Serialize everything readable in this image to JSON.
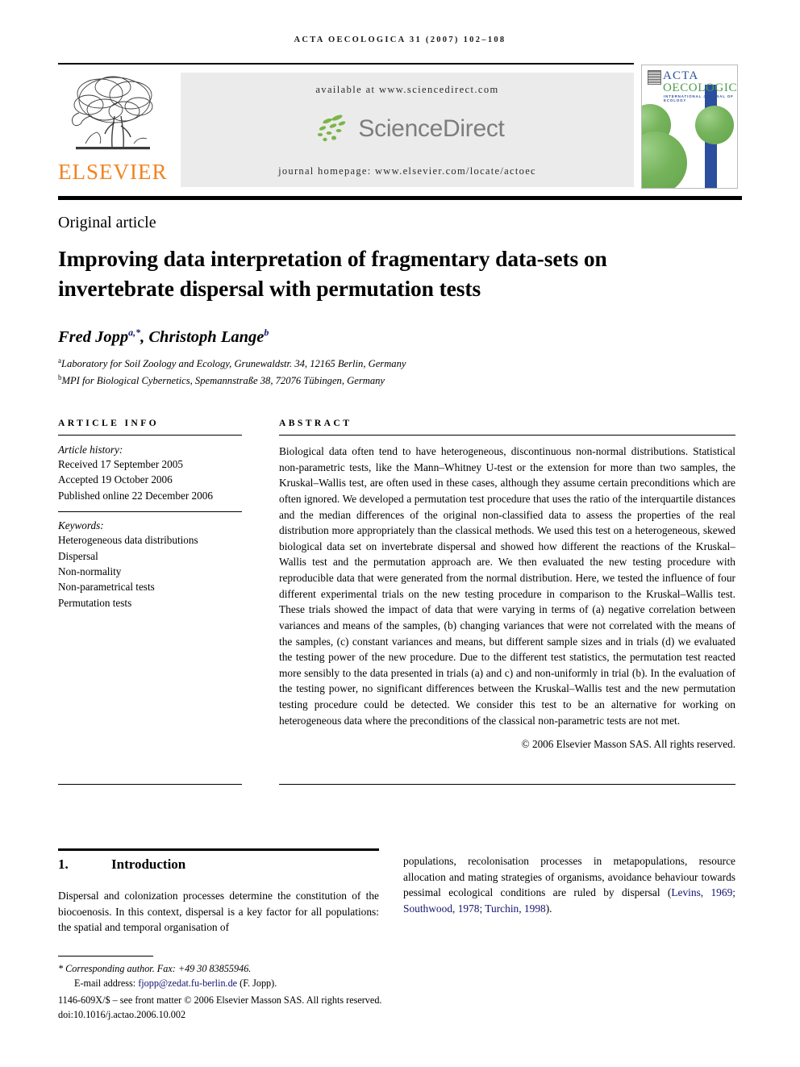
{
  "running_head": "ACTA OECOLOGICA 31 (2007) 102–108",
  "masthead": {
    "publisher_name": "ELSEVIER",
    "available_at": "available at www.sciencedirect.com",
    "sciencedirect_wordmark": "ScienceDirect",
    "journal_homepage": "journal homepage: www.elsevier.com/locate/actoec",
    "cover": {
      "title_line1": "ACTA",
      "title_line2": "OECOLOGICA",
      "subtitle": "INTERNATIONAL JOURNAL OF ECOLOGY"
    }
  },
  "article": {
    "type": "Original article",
    "title": "Improving data interpretation of fragmentary data-sets on invertebrate dispersal with permutation tests",
    "authors": "Fred Jopp, Christoph Lange",
    "author_list": [
      {
        "name": "Fred Jopp",
        "marks": "a,*"
      },
      {
        "name": "Christoph Lange",
        "marks": "b"
      }
    ],
    "affiliations": [
      {
        "mark": "a",
        "text": "Laboratory for Soil Zoology and Ecology, Grunewaldstr. 34, 12165 Berlin, Germany"
      },
      {
        "mark": "b",
        "text": "MPI for Biological Cybernetics, Spemannstraße 38, 72076 Tübingen, Germany"
      }
    ]
  },
  "article_info": {
    "heading": "ARTICLE INFO",
    "history_label": "Article history:",
    "history": [
      "Received 17 September 2005",
      "Accepted 19 October 2006",
      "Published online 22 December 2006"
    ],
    "keywords_label": "Keywords:",
    "keywords": [
      "Heterogeneous data distributions",
      "Dispersal",
      "Non-normality",
      "Non-parametrical tests",
      "Permutation tests"
    ]
  },
  "abstract": {
    "heading": "ABSTRACT",
    "text": "Biological data often tend to have heterogeneous, discontinuous non-normal distributions. Statistical non-parametric tests, like the Mann–Whitney U-test or the extension for more than two samples, the Kruskal–Wallis test, are often used in these cases, although they assume certain preconditions which are often ignored. We developed a permutation test procedure that uses the ratio of the interquartile distances and the median differences of the original non-classified data to assess the properties of the real distribution more appropriately than the classical methods. We used this test on a heterogeneous, skewed biological data set on invertebrate dispersal and showed how different the reactions of the Kruskal–Wallis test and the permutation approach are. We then evaluated the new testing procedure with reproducible data that were generated from the normal distribution. Here, we tested the influence of four different experimental trials on the new testing procedure in comparison to the Kruskal–Wallis test. These trials showed the impact of data that were varying in terms of (a) negative correlation between variances and means of the samples, (b) changing variances that were not correlated with the means of the samples, (c) constant variances and means, but different sample sizes and in trials (d) we evaluated the testing power of the new procedure. Due to the different test statistics, the permutation test reacted more sensibly to the data presented in trials (a) and c) and non-uniformly in trial (b). In the evaluation of the testing power, no significant differences between the Kruskal–Wallis test and the new permutation testing procedure could be detected. We consider this test to be an alternative for working on heterogeneous data where the preconditions of the classical non-parametric tests are not met.",
    "copyright": "© 2006 Elsevier Masson SAS. All rights reserved."
  },
  "introduction": {
    "number": "1.",
    "heading": "Introduction",
    "column_left": "Dispersal and colonization processes determine the constitution of the biocoenosis. In this context, dispersal is a key factor for all populations: the spatial and temporal organisation of",
    "column_right_before_cite": "populations, recolonisation processes in metapopulations, resource allocation and mating strategies of organisms, avoidance behaviour towards pessimal ecological conditions are ruled by dispersal (",
    "citation": "Levins, 1969; Southwood, 1978; Turchin, 1998",
    "column_right_after_cite": ")."
  },
  "footnotes": {
    "corresponding": "* Corresponding author. Fax: +49 30 83855946.",
    "email_label": "E-mail address:",
    "email": "fjopp@zedat.fu-berlin.de",
    "email_suffix": "(F. Jopp).",
    "front_matter": "1146-609X/$ – see front matter © 2006 Elsevier Masson SAS. All rights reserved.",
    "doi": "doi:10.1016/j.actao.2006.10.002"
  },
  "colors": {
    "elsevier_orange": "#F08422",
    "link_blue": "#12146e",
    "panel_gray": "#ebebeb",
    "cover_green": "#63a24c",
    "cover_blue": "#2b4f9e"
  }
}
